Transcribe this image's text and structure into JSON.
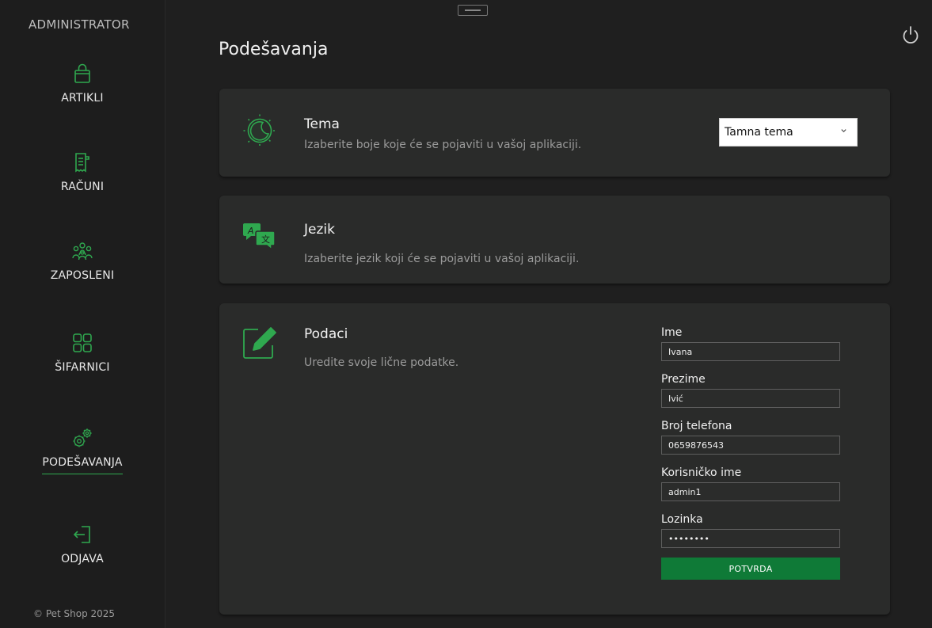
{
  "app": {
    "brand": "ADMINISTRATOR",
    "footer": "© Pet Shop 2025",
    "accent": "#2fa84f",
    "button_color": "#0f7a37"
  },
  "sidebar": {
    "items": [
      {
        "label": "ARTIKLI",
        "icon": "shopping-bag-icon"
      },
      {
        "label": "RAČUNI",
        "icon": "receipt-icon"
      },
      {
        "label": "ZAPOSLENI",
        "icon": "users-icon"
      },
      {
        "label": "ŠIFARNICI",
        "icon": "grid-icon"
      },
      {
        "label": "PODEŠAVANJA",
        "icon": "gears-icon",
        "active": true
      },
      {
        "label": "ODJAVA",
        "icon": "logout-icon"
      }
    ]
  },
  "page": {
    "title": "Podešavanja"
  },
  "theme": {
    "title": "Tema",
    "description": "Izaberite boje koje će se pojaviti u vašoj aplikaciji.",
    "selected": "Tamna tema",
    "icon": "theme-icon"
  },
  "language": {
    "title": "Jezik",
    "description": "Izaberite jezik koji će se pojaviti u vašoj aplikaciji.",
    "icon": "translate-icon"
  },
  "profile": {
    "title": "Podaci",
    "description": "Uredite svoje lične podatke.",
    "icon": "edit-icon",
    "fields": [
      {
        "label": "Ime",
        "value": "Ivana"
      },
      {
        "label": "Prezime",
        "value": "Ivić"
      },
      {
        "label": "Broj telefona",
        "value": "0659876543"
      },
      {
        "label": "Korisničko ime",
        "value": "admin1"
      },
      {
        "label": "Lozinka",
        "value": "••••••••"
      }
    ],
    "submit_label": "POTVRDA"
  }
}
